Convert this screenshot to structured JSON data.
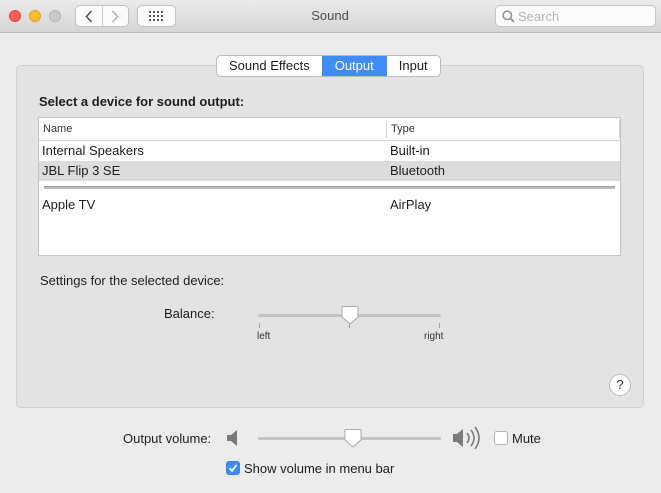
{
  "window": {
    "title": "Sound",
    "search_placeholder": "Search"
  },
  "tabs": [
    {
      "label": "Sound Effects",
      "active": false
    },
    {
      "label": "Output",
      "active": true
    },
    {
      "label": "Input",
      "active": false
    }
  ],
  "output": {
    "heading": "Select a device for sound output:",
    "columns": {
      "name": "Name",
      "type": "Type"
    },
    "devices": [
      {
        "name": "Internal Speakers",
        "type": "Built-in",
        "selected": false
      },
      {
        "name": "JBL Flip 3 SE",
        "type": "Bluetooth",
        "selected": true
      },
      {
        "name": "Apple TV",
        "type": "AirPlay",
        "selected": false
      }
    ],
    "settings_label": "Settings for the selected device:",
    "balance": {
      "label": "Balance:",
      "left_label": "left",
      "right_label": "right",
      "value": 0.5
    },
    "help_label": "?"
  },
  "volume": {
    "label": "Output volume:",
    "value": 0.52,
    "mute_label": "Mute",
    "mute_checked": false,
    "menu_bar_label": "Show volume in menu bar",
    "menu_bar_checked": true
  },
  "colors": {
    "accent": "#3f8cf4",
    "close": "#fe5f57",
    "minimize": "#febc2e",
    "maximize_disabled": "#c9c9c9"
  },
  "icons": {
    "back": "chevron-left-icon",
    "forward": "chevron-right-icon",
    "show_all": "grid-icon",
    "search": "magnifier-icon",
    "speaker_low": "speaker-low-icon",
    "speaker_high": "speaker-high-icon",
    "check": "checkmark-icon"
  }
}
